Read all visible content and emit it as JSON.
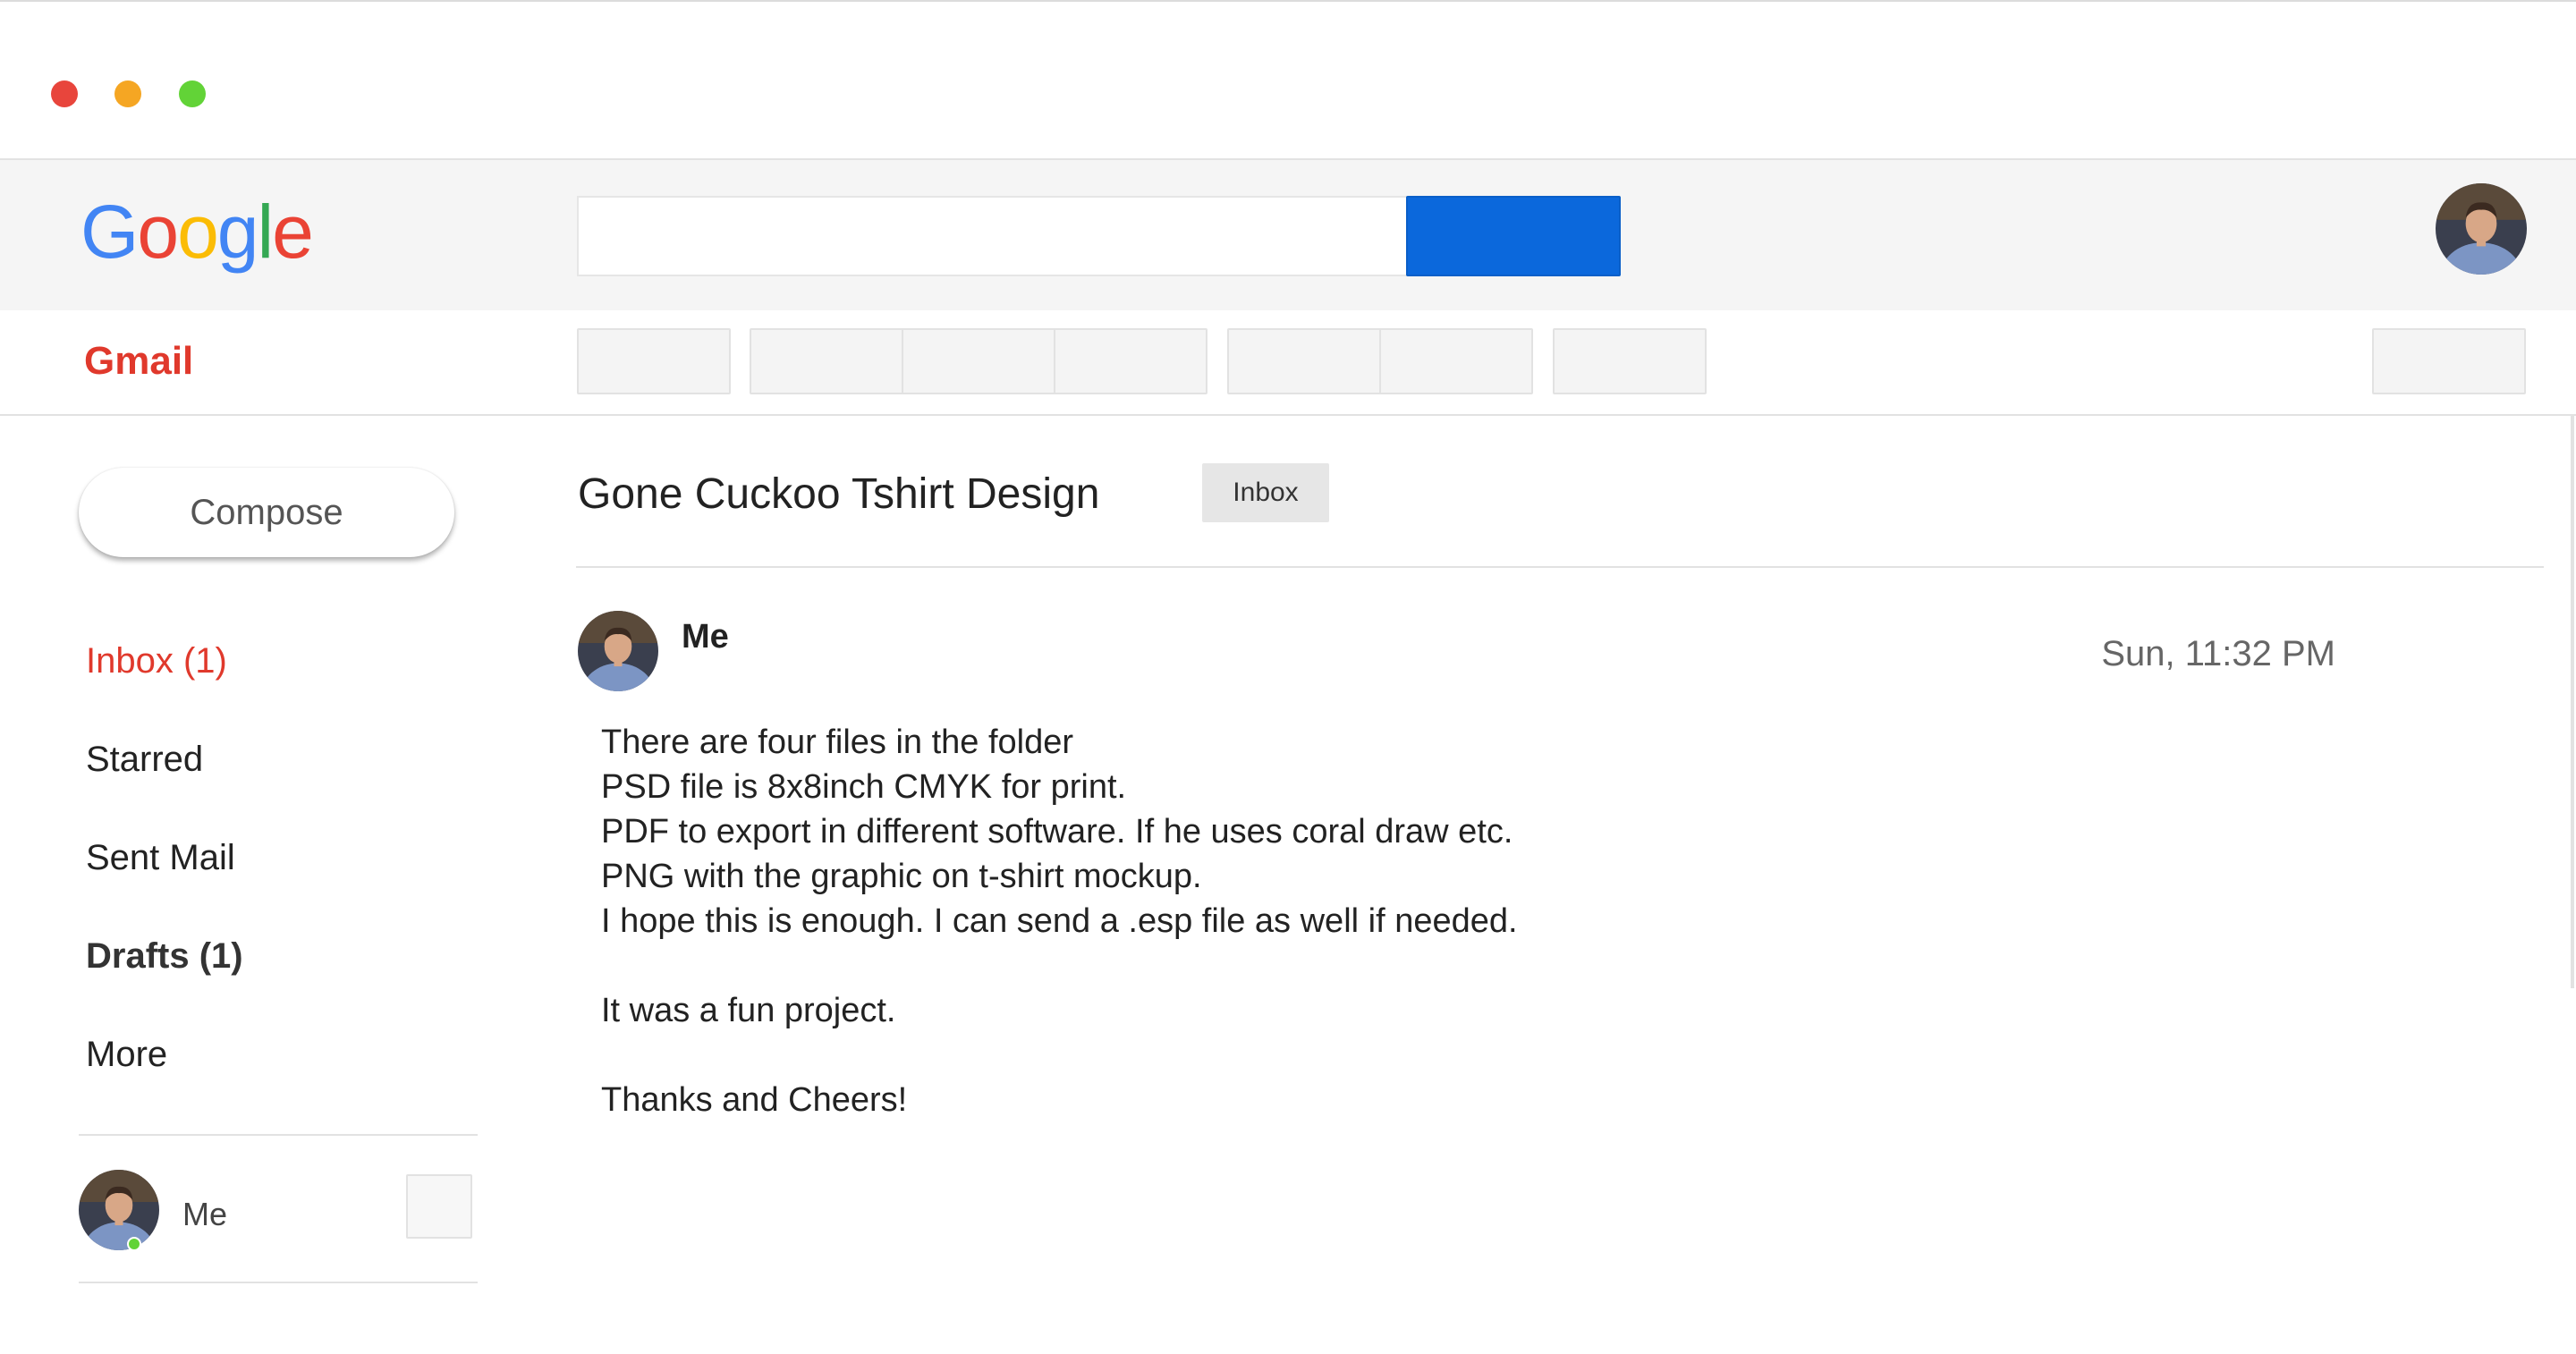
{
  "window": {
    "controls": [
      "close-dot",
      "minimize-dot",
      "maximize-dot"
    ],
    "colors": {
      "close": "#e8453c",
      "minimize": "#f5a623",
      "maximize": "#62d337"
    }
  },
  "header": {
    "logo": {
      "letters": [
        "G",
        "o",
        "o",
        "g",
        "l",
        "e"
      ],
      "colors": [
        "#4285f4",
        "#ea4335",
        "#fbbc05",
        "#4285f4",
        "#34a853",
        "#ea4335"
      ]
    },
    "search": {
      "value": "",
      "placeholder": ""
    },
    "search_button_color": "#0b68dc",
    "account_avatar": "user-avatar"
  },
  "toolbar": {
    "app_label": "Gmail"
  },
  "sidebar": {
    "compose_label": "Compose",
    "items": [
      {
        "label": "Inbox (1)"
      },
      {
        "label": "Starred"
      },
      {
        "label": "Sent Mail"
      },
      {
        "label": "Drafts (1)"
      },
      {
        "label": "More"
      }
    ],
    "chat": {
      "name": "Me",
      "status": "online"
    }
  },
  "message": {
    "subject": "Gone Cuckoo Tshirt Design",
    "label": "Inbox",
    "sender": "Me",
    "timestamp": "Sun, 11:32 PM",
    "body_lines": [
      "There are four files in the folder",
      "PSD file is 8x8inch CMYK for print.",
      "PDF to export in different software. If he uses coral draw etc.",
      "PNG with the graphic on t-shirt mockup.",
      "I hope this is enough. I can send a .esp file as well if needed.",
      "",
      "It was a fun project.",
      "",
      "Thanks and Cheers!"
    ]
  },
  "colors": {
    "accent_red": "#e0392c",
    "header_bg": "#f5f5f5",
    "online": "#62d337"
  }
}
